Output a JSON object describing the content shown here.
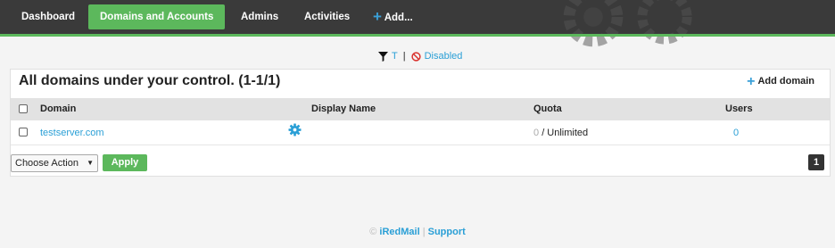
{
  "nav": {
    "items": [
      {
        "label": "Dashboard"
      },
      {
        "label": "Domains and Accounts"
      },
      {
        "label": "Admins"
      },
      {
        "label": "Activities"
      },
      {
        "label": "Add..."
      }
    ]
  },
  "filter": {
    "t_label": "T",
    "separator": "|",
    "disabled_label": "Disabled"
  },
  "panel": {
    "title": "All domains under your control. (1-1/1)",
    "add_domain_label": "Add domain",
    "columns": [
      "Domain",
      "Display Name",
      "Quota",
      "Users"
    ],
    "rows": [
      {
        "domain": "testserver.com",
        "display_name": "",
        "quota_used": "0",
        "quota_limit": "/ Unlimited",
        "users": "0"
      }
    ],
    "action_select": "Choose Action",
    "apply_label": "Apply",
    "page": "1"
  },
  "footer": {
    "copyright": "©",
    "brand": "iRedMail",
    "separator": "|",
    "support": "Support"
  },
  "colors": {
    "nav_bg": "#3a3a3a",
    "accent_green": "#5cb85c",
    "link_blue": "#2a9fd6",
    "disabled_red": "#d9302c"
  },
  "icons": {
    "filter": "filter-funnel-icon",
    "disabled": "disabled-circle-icon",
    "add": "plus-icon",
    "settings": "gear-icon"
  }
}
